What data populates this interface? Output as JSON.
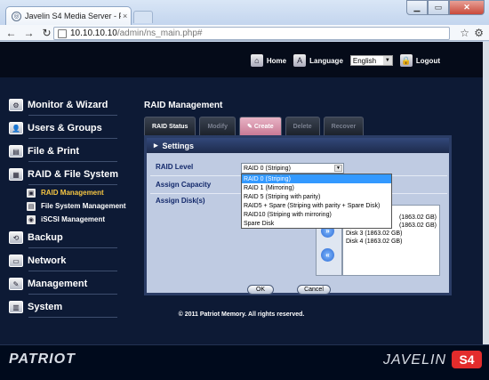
{
  "browser": {
    "tab_title": "Javelin S4 Media Server - P",
    "tab_close": "×",
    "address_host": "10.10.10.10",
    "address_path": "/admin/ns_main.php#"
  },
  "topbar": {
    "home": "Home",
    "language_label": "Language",
    "language_value": "English",
    "logout": "Logout"
  },
  "sidebar": {
    "items": [
      {
        "label": "Monitor & Wizard"
      },
      {
        "label": "Users & Groups"
      },
      {
        "label": "File & Print"
      },
      {
        "label": "RAID & File System"
      },
      {
        "label": "Backup"
      },
      {
        "label": "Network"
      },
      {
        "label": "Management"
      },
      {
        "label": "System"
      }
    ],
    "sub_items": [
      {
        "label": "RAID Management",
        "active": true
      },
      {
        "label": "File System Management"
      },
      {
        "label": "iSCSI Management"
      }
    ]
  },
  "main": {
    "title": "RAID Management",
    "tabs": [
      "RAID Status",
      "Modify",
      "Create",
      "Delete",
      "Recover"
    ],
    "panel_title": "Settings",
    "raid_level_label": "RAID Level",
    "assign_capacity_label": "Assign Capacity",
    "assign_disks_label": "Assign Disk(s)",
    "raid_level_value": "RAID 0 (Striping)",
    "raid_options": [
      "RAID 0 (Striping)",
      "RAID 1 (Mirroring)",
      "RAID 5 (Striping with parity)",
      "RAID5 + Spare (Striping with parity + Spare Disk)",
      "RAID10 (Striping with mirroring)",
      "Spare Disk"
    ],
    "disks": [
      "(1863.02 GB)",
      "(1863.02 GB)",
      "Disk 3 (1863.02 GB)",
      "Disk 4 (1863.02 GB)"
    ],
    "ok_label": "OK",
    "cancel_label": "Cancel"
  },
  "copyright": "© 2011 Patriot Memory. All rights reserved.",
  "footer": {
    "brand_left": "PATRIOT",
    "brand_right": "JAVELIN",
    "model": "S4"
  }
}
